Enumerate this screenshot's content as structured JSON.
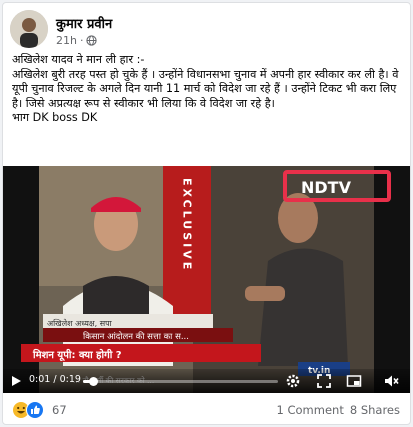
{
  "post": {
    "author": "कुमार प्रवीन",
    "time": "21h",
    "dot": "·",
    "lines": [
      "अखिलेश यादव ने मान ली हार :-",
      "अखिलेश बुरी तरह पस्त हो चुके हैं । उन्होंने विधानसभा चुनाव में अपनी हार स्वीकार कर ली है। वे यूपी चुनाव रिजल्ट के अगले दिन यानी 11 मार्च को विदेश जा रहे हैं । उन्होंने टिकट भी करा लिए है। जिसे अप्रत्यक्ष रूप से स्वीकार भी लिया कि वे विदेश जा रहे है।",
      "भाग DK boss DK"
    ]
  },
  "video": {
    "time_display": "0:01 / 0:19",
    "progress_fraction": 0.05,
    "logo_text": "NDTV",
    "exclusive_text": "EXCLUSIVE",
    "nameplate": "अखिलेश    अध्यक्ष, सपा",
    "ticker_1": "किसान आंदोलन की सत्ता का स...",
    "ticker_2": "मिशन यूपी: क्या होगी ?",
    "corner_brand": "tv.in",
    "bottom_ticker": "... नौ कर्मी की सरकार को ..."
  },
  "footer": {
    "reaction_count": "67",
    "comments": "1 Comment",
    "shares": "8 Shares"
  },
  "colors": {
    "highlight_box": "#e8304a",
    "like_blue": "#1877f2",
    "haha_yellow": "#f7b928"
  }
}
